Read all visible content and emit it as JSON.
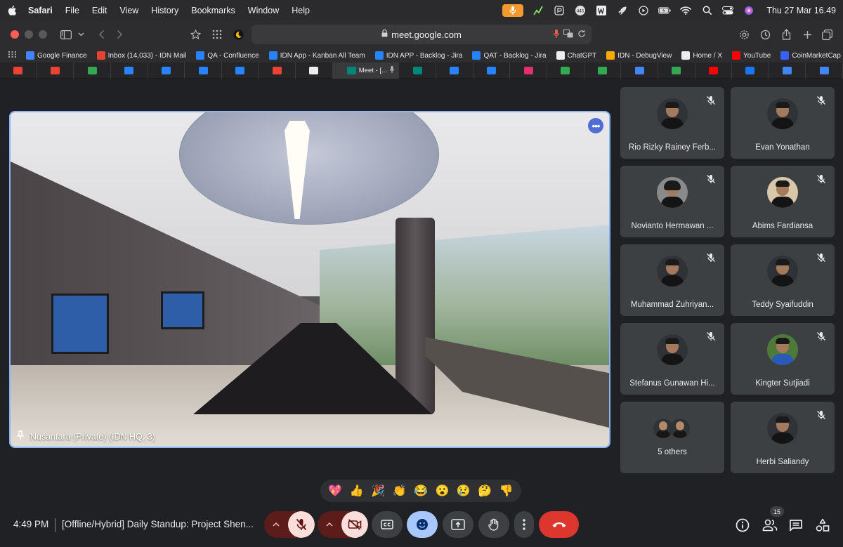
{
  "menubar": {
    "app_name": "Safari",
    "menus": [
      "File",
      "Edit",
      "View",
      "History",
      "Bookmarks",
      "Window",
      "Help"
    ],
    "clock": "Thu 27 Mar  16.49",
    "tray_icons": [
      "recording-icon",
      "graph-icon",
      "pen-icon",
      "badge-443-icon",
      "word-icon",
      "rocket-icon",
      "play-icon",
      "battery-icon",
      "wifi-icon",
      "search-icon",
      "control-center-icon",
      "siri-icon"
    ]
  },
  "toolbar": {
    "url": "meet.google.com"
  },
  "bookmarks": [
    {
      "label": "Google Finance",
      "color": "#4285f4"
    },
    {
      "label": "Inbox (14,033) - IDN Mail",
      "color": "#ea4335"
    },
    {
      "label": "QA - Confluence",
      "color": "#2684ff"
    },
    {
      "label": "IDN App - Kanban All Team",
      "color": "#2684ff"
    },
    {
      "label": "IDN APP - Backlog - Jira",
      "color": "#2684ff"
    },
    {
      "label": "QAT - Backlog - Jira",
      "color": "#2684ff"
    },
    {
      "label": "ChatGPT",
      "color": "#eeeeee"
    },
    {
      "label": "IDN - DebugView",
      "color": "#f9ab00"
    },
    {
      "label": "Home / X",
      "color": "#eeeeee"
    },
    {
      "label": "YouTube",
      "color": "#ff0000"
    },
    {
      "label": "CoinMarketCap",
      "color": "#3861fb"
    }
  ],
  "tabs": {
    "active_label": "Meet - [...",
    "favicon_colors": [
      "#ea4335",
      "#ea4335",
      "#34a853",
      "#2684ff",
      "#2684ff",
      "#2684ff",
      "#2684ff",
      "#ea4335",
      "#eeeeee",
      "#00897b",
      "#2684ff",
      "#2684ff",
      "#e1306c",
      "#34a853",
      "#34a853",
      "#4285f4",
      "#34a853",
      "#ff0000",
      "#1877f2",
      "#4285f4",
      "#4285f4"
    ]
  },
  "stage": {
    "label": "Nusantara (Private) (IDN HQ, 3)"
  },
  "participants": [
    {
      "name": "Rio Rizky Rainey Ferb..."
    },
    {
      "name": "Evan Yonathan"
    },
    {
      "name": "Novianto Hermawan ..."
    },
    {
      "name": "Abims Fardiansa"
    },
    {
      "name": "Muhammad Zuhriyan..."
    },
    {
      "name": "Teddy Syaifuddin"
    },
    {
      "name": "Stefanus Gunawan Hi..."
    },
    {
      "name": "Kingter Sutjiadi"
    },
    {
      "name": "5 others"
    },
    {
      "name": "Herbi Saliandy"
    }
  ],
  "reactions": [
    "💖",
    "👍",
    "🎉",
    "👏",
    "😂",
    "😮",
    "😢",
    "🤔",
    "👎"
  ],
  "bottom": {
    "time": "4:49 PM",
    "meeting_title": "[Offline/Hybrid] Daily Standup: Project Shen...",
    "people_count": "15"
  },
  "colors": {
    "background": "#202124",
    "tile": "#3c4043",
    "accent_border": "#8ab4f8",
    "end_call": "#ea4335",
    "muted_bg": "#f9dedc",
    "muted_chevron_bg": "#5c1c1a"
  }
}
